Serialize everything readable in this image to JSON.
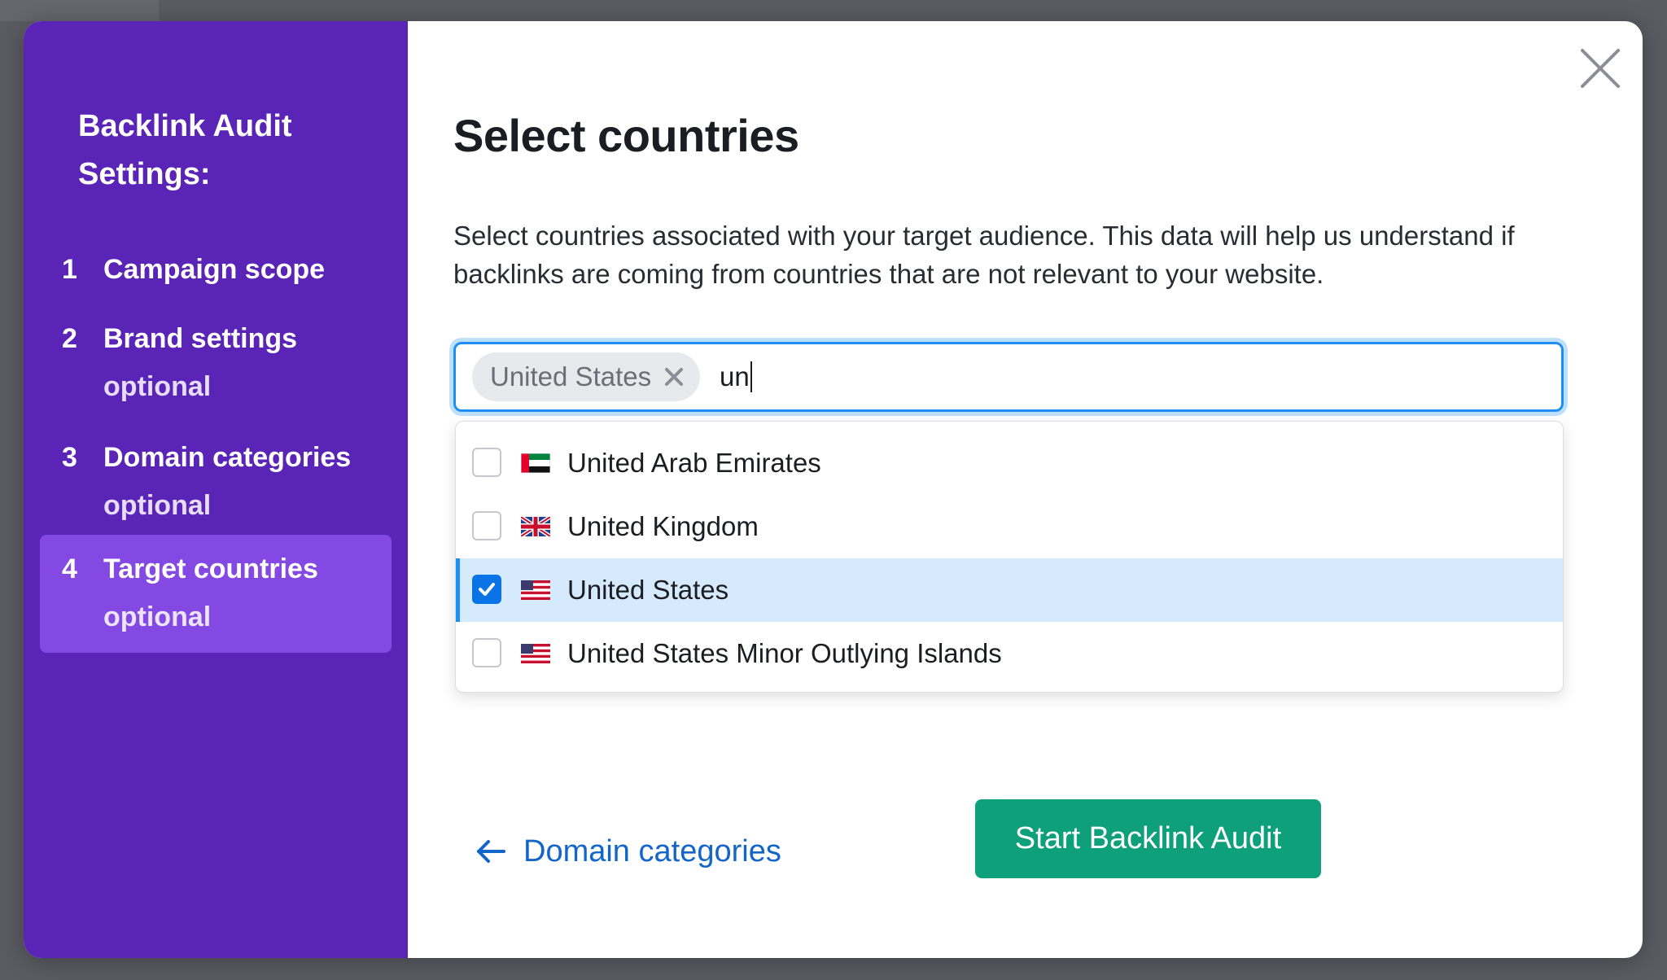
{
  "sidebar": {
    "title_line1": "Backlink Audit",
    "title_line2": "Settings:",
    "steps": [
      {
        "number": "1",
        "label": "Campaign scope",
        "sub": ""
      },
      {
        "number": "2",
        "label": "Brand settings",
        "sub": "optional"
      },
      {
        "number": "3",
        "label": "Domain categories",
        "sub": "optional"
      },
      {
        "number": "4",
        "label": "Target countries",
        "sub": "optional"
      }
    ],
    "active_step": 4
  },
  "dialog": {
    "close_icon": "close-icon",
    "title": "Select countries",
    "description": "Select countries associated with your target audience. This data will help us understand if backlinks are coming from countries that are not relevant to your website."
  },
  "country_input": {
    "chips": [
      {
        "label": "United States"
      }
    ],
    "value": "un"
  },
  "dropdown": {
    "options": [
      {
        "label": "United Arab Emirates",
        "flag": "ae-flag-icon",
        "checked": false
      },
      {
        "label": "United Kingdom",
        "flag": "gb-flag-icon",
        "checked": false
      },
      {
        "label": "United States",
        "flag": "us-flag-icon",
        "checked": true
      },
      {
        "label": "United States Minor Outlying Islands",
        "flag": "us-flag-icon",
        "checked": false
      }
    ]
  },
  "footer": {
    "back_label": "Domain categories",
    "back_icon": "arrow-left-icon",
    "primary_label": "Start Backlink Audit"
  },
  "colors": {
    "sidebar_bg": "#5a24b7",
    "active_step_bg": "#8448e3",
    "primary_button": "#0e9f7b",
    "link": "#1366c9",
    "focus_border": "#1f8ef4",
    "selected_row": "#d6eafe"
  }
}
